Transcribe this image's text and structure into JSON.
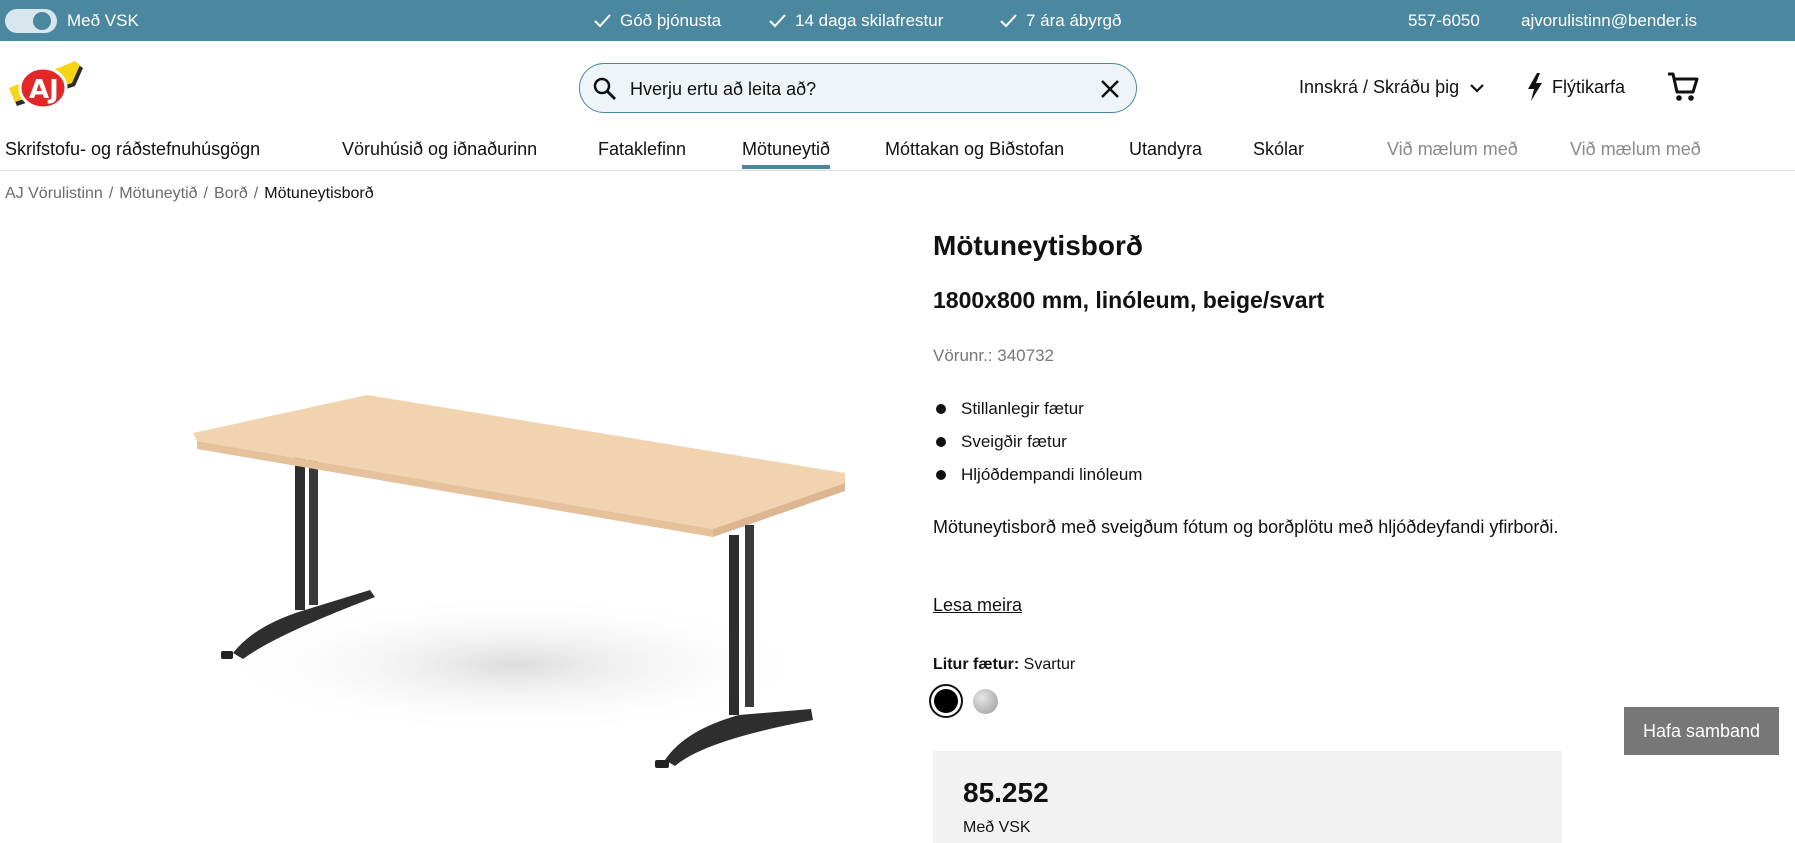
{
  "topbar": {
    "vat_toggle_label": "Með VSK",
    "usps": [
      "Góð þjónusta",
      "14 daga skilafrestur",
      "7 ára ábyrgð"
    ],
    "phone": "557-6050",
    "email": "ajvorulistinn@bender.is",
    "colors": {
      "background": "#4b889f"
    }
  },
  "header": {
    "logo_text": "AJ",
    "search": {
      "placeholder": "Hverju ertu að leita að?"
    },
    "login_label": "Innskrá / Skráðu þig",
    "quick_cart_label": "Flýtikarfa",
    "icons": [
      "search-icon",
      "clear-icon",
      "chevron-down-icon",
      "lightning-icon",
      "cart-icon"
    ]
  },
  "nav": {
    "items": [
      {
        "label": "Skrifstofu- og ráðstefnuhúsgögn"
      },
      {
        "label": "Vöruhúsið og iðnaðurinn"
      },
      {
        "label": "Fataklefinn"
      },
      {
        "label": "Mötuneytið",
        "active": true
      },
      {
        "label": "Móttakan og Biðstofan"
      },
      {
        "label": "Utandyra"
      },
      {
        "label": "Skólar"
      },
      {
        "label": "Við mælum með"
      },
      {
        "label": "Við mælum með"
      }
    ]
  },
  "breadcrumb": {
    "items": [
      "AJ Vörulistinn",
      "Mötuneytið",
      "Borð"
    ],
    "current": "Mötuneytisborð",
    "separator": "/"
  },
  "product": {
    "title": "Mötuneytisborð",
    "subtitle": "1800x800 mm, linóleum, beige/svart",
    "sku": "Vörunr.: 340732",
    "features": [
      "Stillanlegir fætur",
      "Sveigðir fætur",
      "Hljóðdempandi linóleum"
    ],
    "description": "Mötuneytisborð með sveigðum fótum og borðplötu með hljóðdeyfandi yfirborði.",
    "read_more": "Lesa meira",
    "color_label": "Litur fætur:",
    "color_value": "Svartur",
    "swatches": [
      {
        "name": "black",
        "color": "#000000",
        "selected": true
      },
      {
        "name": "silver",
        "color": "#b5b5b5",
        "selected": false
      }
    ],
    "price": "85.252",
    "price_note": "Með VSK"
  },
  "contact_button": "Hafa samband"
}
